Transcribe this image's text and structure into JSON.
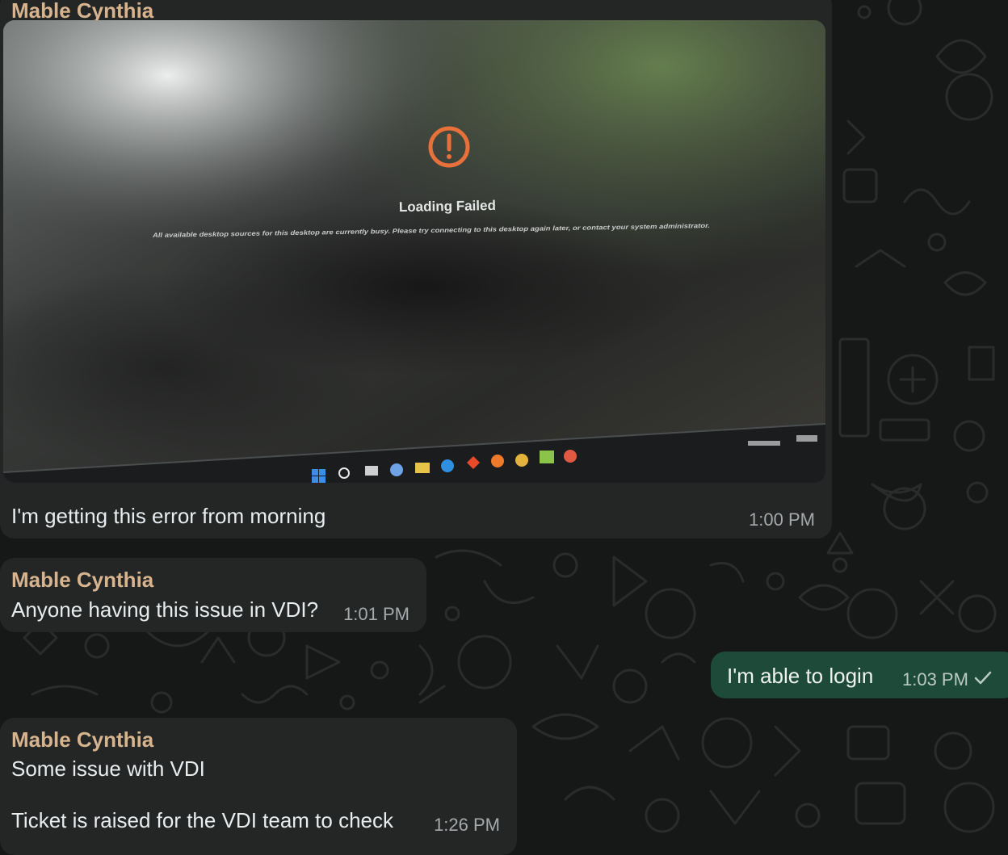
{
  "messages": [
    {
      "sender": "Mable Cynthia",
      "photo": {
        "error_title": "Loading Failed",
        "error_detail": "All available desktop sources for this desktop are currently busy. Please try connecting to this desktop again later, or contact your system administrator."
      },
      "text": "I'm getting this error from morning",
      "time": "1:00 PM"
    },
    {
      "sender": "Mable Cynthia",
      "text": "Anyone having this issue in VDI?",
      "time": "1:01 PM"
    },
    {
      "outgoing": true,
      "text": "I'm able to login",
      "time": "1:03 PM",
      "status_icon": "single-check-icon"
    },
    {
      "sender": "Mable Cynthia",
      "text_line1": "Some issue with VDI",
      "text_line2": "Ticket is raised for the VDI team to check",
      "time": "1:26 PM"
    }
  ],
  "colors": {
    "chat_background": "#161717",
    "incoming_bubble": "#242626",
    "outgoing_bubble": "#1d4a39",
    "sender_name": "#d8b48e",
    "error_icon": "#e8703a"
  }
}
